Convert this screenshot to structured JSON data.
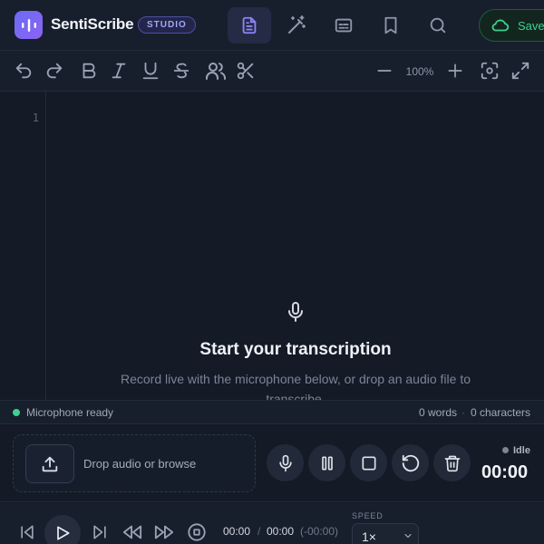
{
  "app": {
    "name": "SentiScribe",
    "badge": "STUDIO",
    "saved_label": "Saved",
    "accent": "#8b85f6",
    "success": "#3fcf8e"
  },
  "nav": {
    "tabs": [
      {
        "icon": "document-icon",
        "active": true
      },
      {
        "icon": "magic-wand-icon",
        "active": false
      },
      {
        "icon": "captions-icon",
        "active": false
      },
      {
        "icon": "bookmark-icon",
        "active": false
      },
      {
        "icon": "search-icon",
        "active": false
      }
    ]
  },
  "toolbar": {
    "tools": [
      "undo-icon",
      "redo-icon",
      "bold-icon",
      "italic-icon",
      "underline-icon",
      "strikethrough-icon",
      "speakers-icon",
      "scissors-icon"
    ],
    "zoom_level": "100%",
    "view_tools": [
      "zoom-out-icon",
      "zoom-in-icon",
      "focus-icon",
      "fullscreen-icon"
    ]
  },
  "editor": {
    "line_number": "1",
    "empty_title": "Start your transcription",
    "empty_subtitle": "Record live with the microphone below, or drop an audio file to transcribe."
  },
  "status": {
    "mic_status": "Microphone ready",
    "words": "0 words",
    "separator": "·",
    "characters": "0 characters"
  },
  "recorder": {
    "drop_label": "Drop audio or browse",
    "state": "Idle",
    "timer": "00:00",
    "controls": [
      "microphone-icon",
      "pause-icon",
      "stop-icon",
      "reset-icon",
      "trash-icon"
    ]
  },
  "playback": {
    "current_time": "00:00",
    "time_separator": "/",
    "duration": "00:00",
    "remaining": "(-00:00)",
    "speed_label": "SPEED",
    "speed_value": "1×"
  }
}
